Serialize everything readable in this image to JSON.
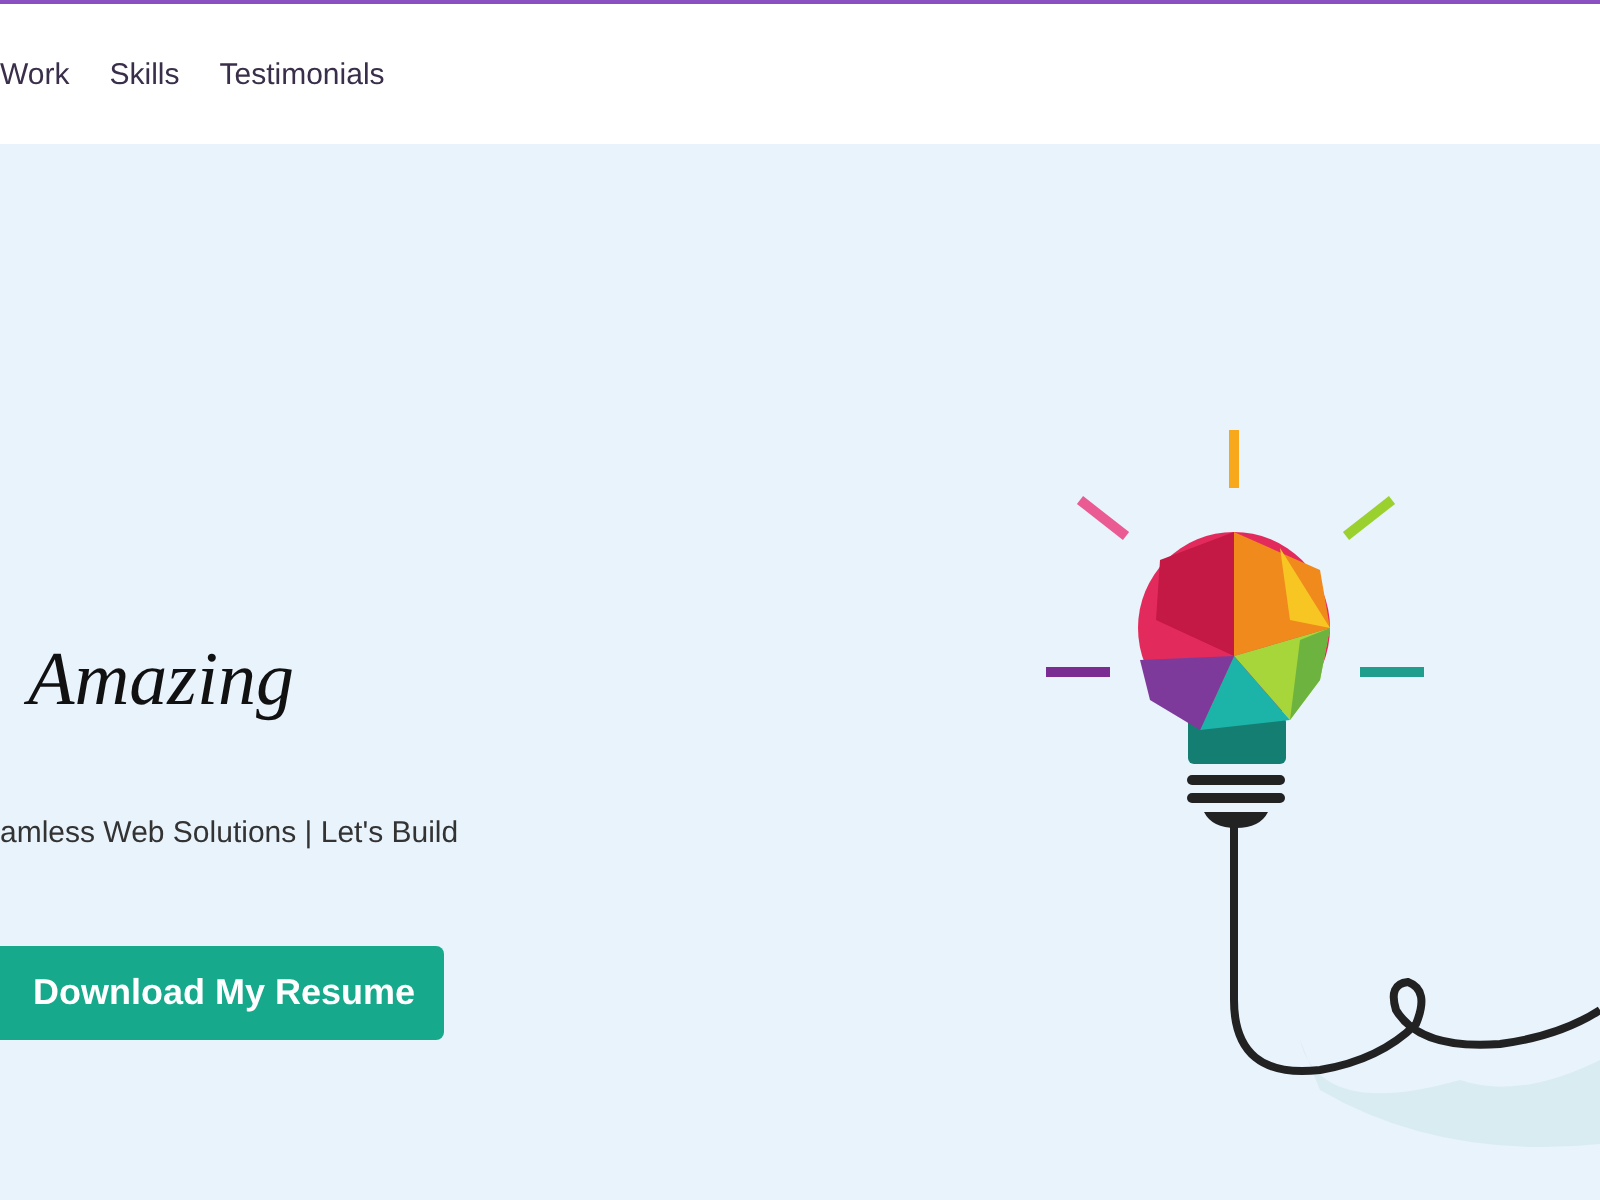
{
  "nav": {
    "links": [
      {
        "label": "Work"
      },
      {
        "label": "Skills"
      },
      {
        "label": "Testimonials"
      }
    ]
  },
  "hero": {
    "heading": "Amazing",
    "subtitle": "amless Web Solutions | Let's Build",
    "button": "Download My Resume"
  }
}
